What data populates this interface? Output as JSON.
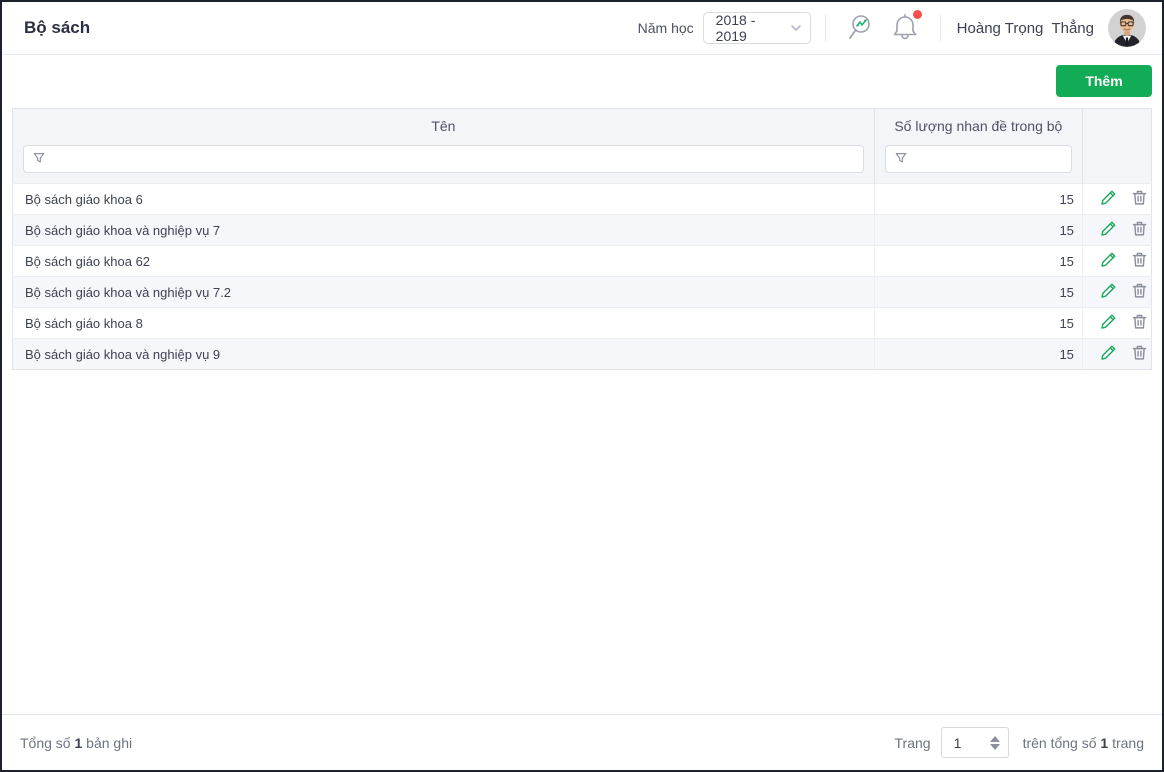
{
  "header": {
    "title": "Bộ sách",
    "school_year_label": "Năm học",
    "school_year_value": "2018 - 2019",
    "user_name": "Hoàng Trọng  Thẳng"
  },
  "toolbar": {
    "add_label": "Thêm"
  },
  "table": {
    "columns": [
      {
        "label": "Tên"
      },
      {
        "label": "Số lượng nhan đề trong bộ"
      },
      {
        "label": ""
      }
    ],
    "filter_icon": "funnel-icon",
    "rows": [
      {
        "name": "Bộ sách giáo khoa 6",
        "count": "15"
      },
      {
        "name": "Bộ sách giáo khoa và nghiệp vụ 7",
        "count": "15"
      },
      {
        "name": "Bộ sách giáo khoa 62",
        "count": "15"
      },
      {
        "name": "Bộ sách giáo khoa và nghiệp vụ 7.2",
        "count": "15"
      },
      {
        "name": "Bộ sách giáo khoa 8",
        "count": "15"
      },
      {
        "name": "Bộ sách giáo khoa và nghiệp vụ 9",
        "count": "15"
      }
    ],
    "row_actions": [
      "edit",
      "delete"
    ]
  },
  "footer": {
    "total_prefix": "Tổng số",
    "total_count": "1",
    "total_suffix": "bản ghi",
    "page_label": "Trang",
    "page_value": "1",
    "pages_prefix": "trên tổng số",
    "pages_count": "1",
    "pages_suffix": "trang"
  },
  "colors": {
    "accent_green": "#12ab56",
    "icon_green": "#1ca95e",
    "icon_gray": "#9298a6",
    "notification_red": "#f4504d",
    "header_bg": "#f4f5f9",
    "zebra_bg": "#f6f7fb",
    "border": "#e2e4ed"
  }
}
